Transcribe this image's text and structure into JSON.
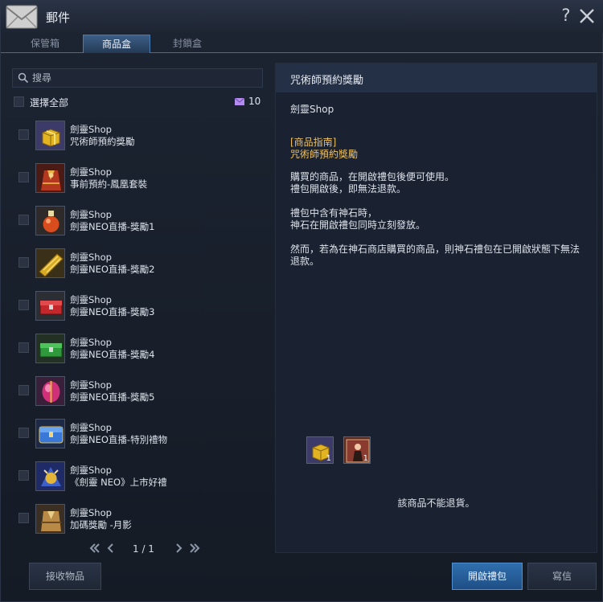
{
  "window": {
    "title": "郵件"
  },
  "tabs": [
    {
      "label": "保管箱",
      "active": false
    },
    {
      "label": "商品盒",
      "active": true
    },
    {
      "label": "封鎖盒",
      "active": false
    }
  ],
  "search": {
    "placeholder": "搜尋"
  },
  "select_all": {
    "label": "選擇全部",
    "mail_count": "10"
  },
  "items": [
    {
      "sender": "劍靈Shop",
      "subject": "咒術師預約獎勵",
      "icon": "gold-gift-box-icon"
    },
    {
      "sender": "劍靈Shop",
      "subject": "事前預約-鳳凰套裝",
      "icon": "phoenix-outfit-icon"
    },
    {
      "sender": "劍靈Shop",
      "subject": "劍靈NEO直播-獎勵1",
      "icon": "red-potion-icon"
    },
    {
      "sender": "劍靈Shop",
      "subject": "劍靈NEO直播-獎勵2",
      "icon": "gold-ticket-bundle-icon"
    },
    {
      "sender": "劍靈Shop",
      "subject": "劍靈NEO直播-獎勵3",
      "icon": "red-chest-icon"
    },
    {
      "sender": "劍靈Shop",
      "subject": "劍靈NEO直播-獎勵4",
      "icon": "green-chest-icon"
    },
    {
      "sender": "劍靈Shop",
      "subject": "劍靈NEO直播-獎勵5",
      "icon": "pink-gem-icon"
    },
    {
      "sender": "劍靈Shop",
      "subject": "劍靈NEO直播-特別禮物",
      "icon": "blue-chest-icon"
    },
    {
      "sender": "劍靈Shop",
      "subject": "《劍靈 NEO》上市好禮",
      "icon": "neo-gift-icon"
    },
    {
      "sender": "劍靈Shop",
      "subject": "加碼獎勵 -月影",
      "icon": "moonshadow-outfit-icon"
    }
  ],
  "pager": {
    "page": "1 / 1"
  },
  "detail": {
    "title": "咒術師預約獎勵",
    "sender": "劍靈Shop",
    "guide_heading": "[商品指南]",
    "guide_name": "咒術師預約獎勵",
    "body": [
      "購買的商品，在開啟禮包後便可使用。",
      "禮包開啟後，即無法退款。",
      "禮包中含有神石時，",
      "神石在開啟禮包同時立刻發放。",
      "然而，若為在神石商店購買的商品，則神石禮包在已開啟狀態下無法",
      "退款。"
    ],
    "attachments": [
      {
        "icon": "gold-gift-box-icon",
        "qty": "1"
      },
      {
        "icon": "character-portrait-icon",
        "qty": "1"
      }
    ],
    "note": "該商品不能退貨。"
  },
  "buttons": {
    "receive": "接收物品",
    "open_package": "開啟禮包",
    "write": "寫信"
  },
  "colors": {
    "accent": "#2f6fae",
    "guide_text": "#f1c15a",
    "mail_icon": "#b48cf0"
  }
}
